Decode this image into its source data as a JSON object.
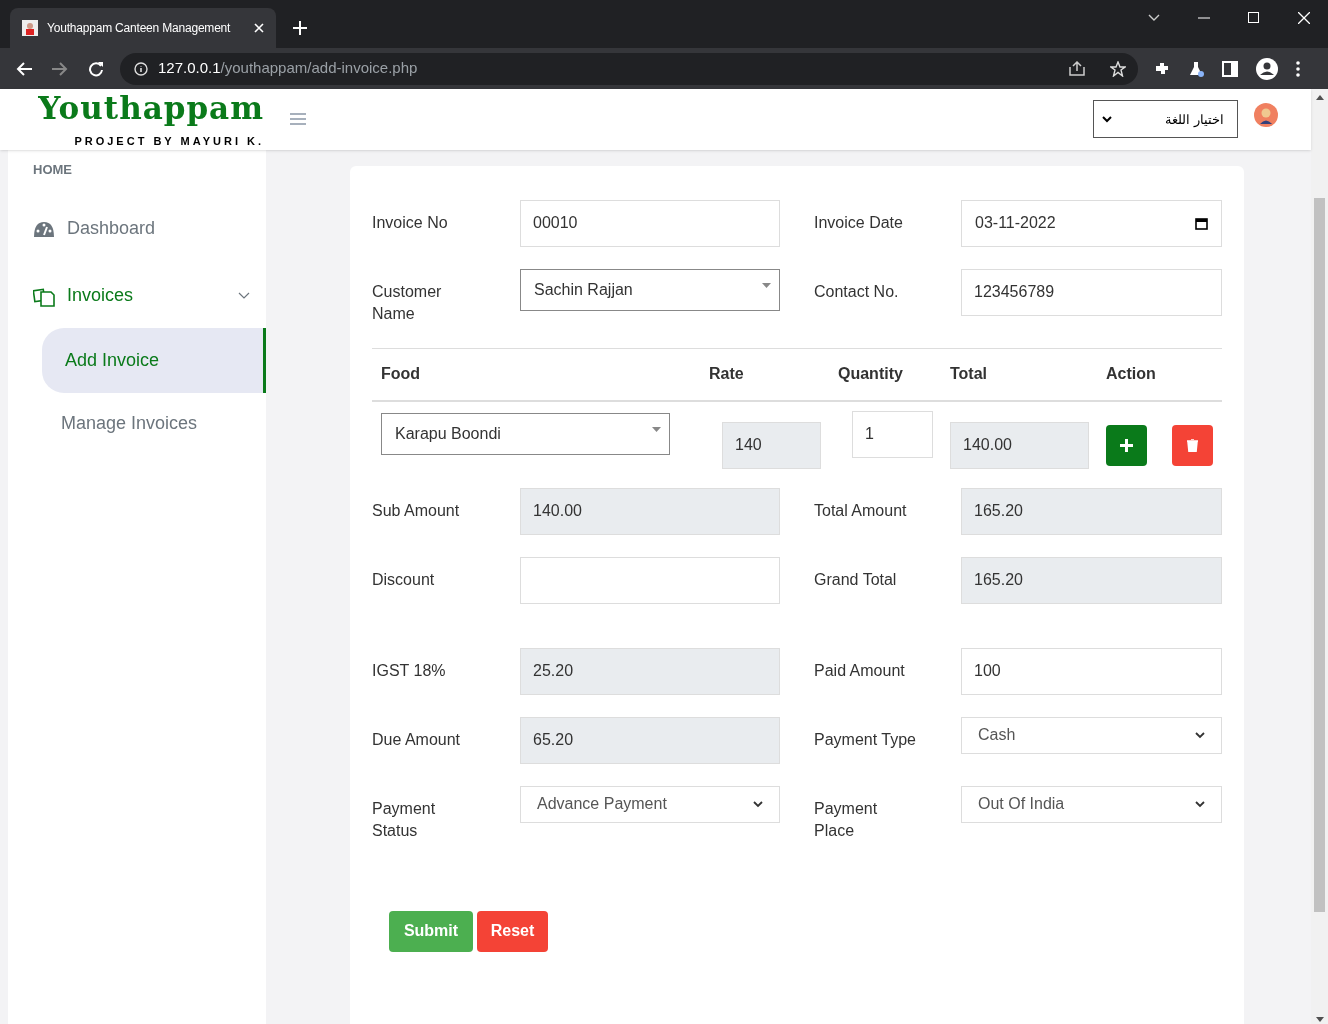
{
  "browser": {
    "tab_title": "Youthappam Canteen Management",
    "url_host": "127.0.0.1",
    "url_path": "/youthappam/add-invoice.php"
  },
  "header": {
    "logo": "Youthappam",
    "tagline": "PROJECT BY MAYURI K.",
    "language_select": "اختيار اللغة"
  },
  "sidebar": {
    "section": "HOME",
    "items": [
      {
        "label": "Dashboard",
        "kind": "gauge",
        "selected": false
      },
      {
        "label": "Invoices",
        "kind": "copy",
        "selected": true,
        "expanded": true,
        "children": [
          {
            "label": "Add Invoice",
            "selected": true
          },
          {
            "label": "Manage Invoices",
            "selected": false
          }
        ]
      }
    ]
  },
  "form": {
    "top_rows": [
      [
        {
          "label": "Invoice No",
          "kind": "text",
          "value": "00010"
        },
        {
          "label": "Invoice Date",
          "kind": "date",
          "value": "03-11-2022"
        }
      ],
      [
        {
          "label": "Customer Name",
          "kind": "combo",
          "value": "Sachin Rajjan"
        },
        {
          "label": "Contact No.",
          "kind": "text",
          "value": "123456789"
        }
      ]
    ],
    "items_table": {
      "columns": [
        "Food",
        "Rate",
        "Quantity",
        "Total",
        "Action"
      ],
      "rows": [
        {
          "food": "Karapu Boondi",
          "rate": "140",
          "quantity": "1",
          "total": "140.00"
        }
      ]
    },
    "summary_rows": [
      [
        {
          "label": "Sub Amount",
          "kind": "readonly",
          "value": "140.00"
        },
        {
          "label": "Total Amount",
          "kind": "readonly",
          "value": "165.20"
        }
      ],
      [
        {
          "label": "Discount",
          "kind": "text"
        },
        {
          "label": "Grand Total",
          "kind": "readonly",
          "value": "165.20"
        }
      ]
    ],
    "payment_rows": [
      [
        {
          "label": "IGST 18%",
          "kind": "readonly",
          "value": "25.20"
        },
        {
          "label": "Paid Amount",
          "kind": "text",
          "value": "100"
        }
      ],
      [
        {
          "label": "Due Amount",
          "kind": "readonly",
          "value": "65.20"
        },
        {
          "label": "Payment Type",
          "kind": "select",
          "value": "Cash"
        }
      ],
      [
        {
          "label": "Payment Status",
          "kind": "select",
          "value": "Advance Payment"
        },
        {
          "label": "Payment Place",
          "kind": "select",
          "value": "Out Of India"
        }
      ]
    ],
    "buttons": [
      {
        "label": "Submit",
        "kind": "submit"
      },
      {
        "label": "Reset",
        "kind": "reset"
      }
    ]
  }
}
